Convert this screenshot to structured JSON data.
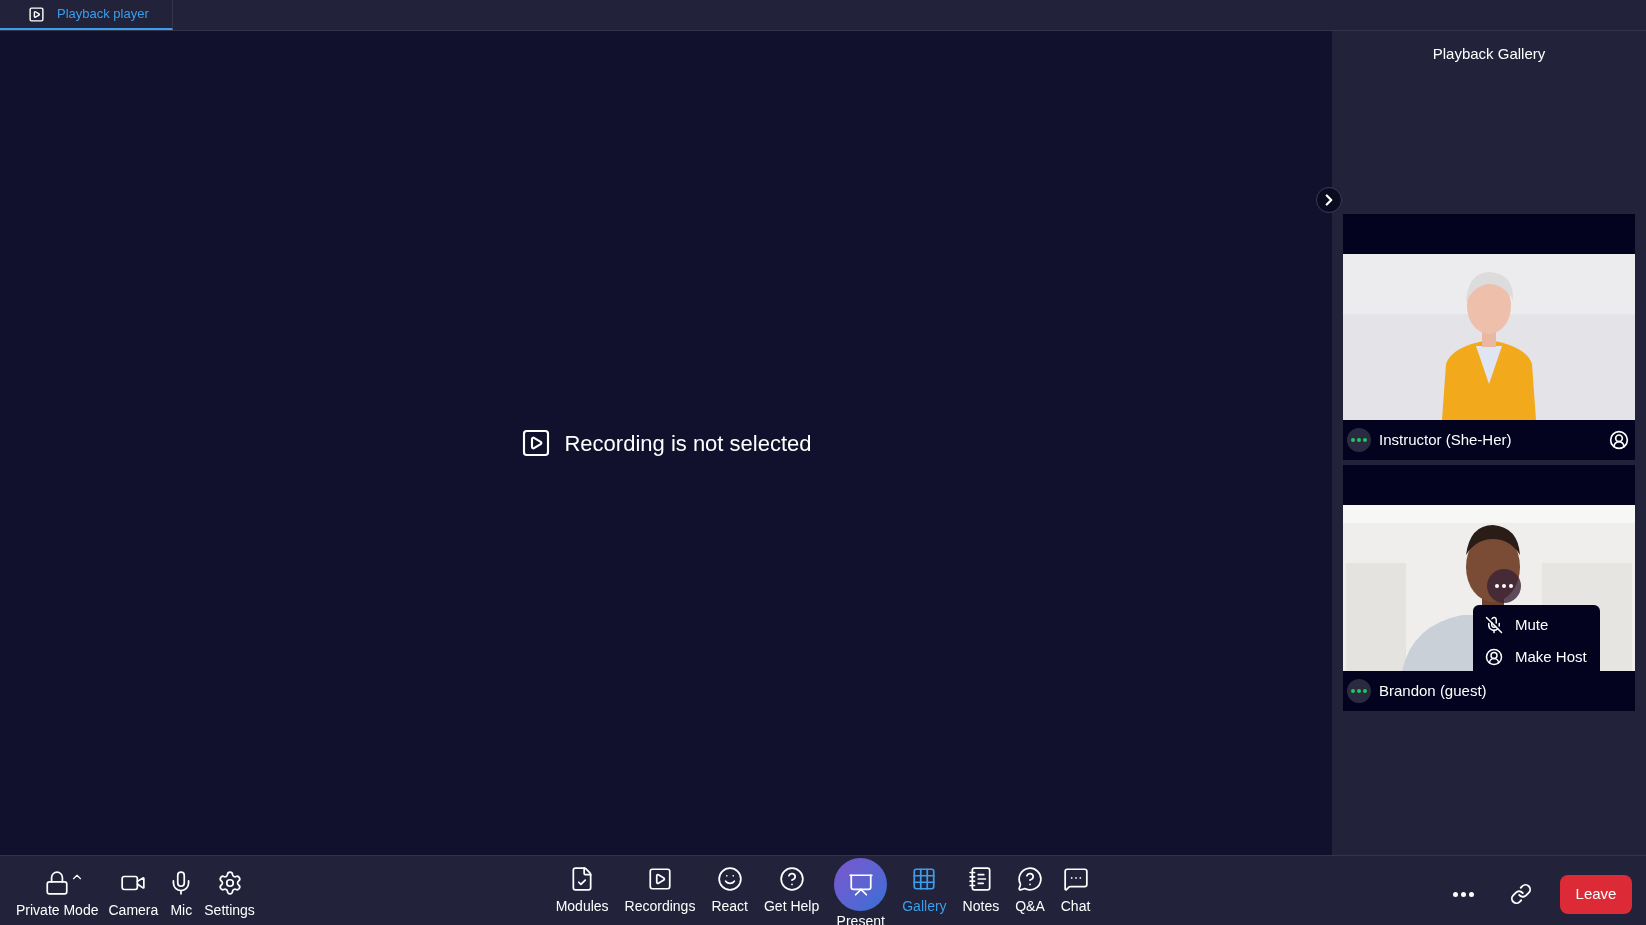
{
  "tab": {
    "label": "Playback player",
    "selected": true
  },
  "main": {
    "message": "Recording is not selected"
  },
  "gallery": {
    "title": "Playback Gallery",
    "tiles": [
      {
        "name": "Instructor (She-Her)",
        "host": true,
        "menu_open": false
      },
      {
        "name": "Brandon (guest)",
        "host": false,
        "menu_open": true,
        "menu": [
          {
            "label": "Mute"
          },
          {
            "label": "Make Host"
          }
        ]
      }
    ]
  },
  "toolbar": {
    "left": [
      {
        "label": "Private Mode"
      },
      {
        "label": "Camera"
      },
      {
        "label": "Mic"
      },
      {
        "label": "Settings"
      }
    ],
    "center": [
      {
        "label": "Modules",
        "kind": "plain",
        "selected": false
      },
      {
        "label": "Recordings",
        "kind": "plain",
        "selected": false
      },
      {
        "label": "React",
        "kind": "plain",
        "selected": false
      },
      {
        "label": "Get Help",
        "kind": "plain",
        "selected": false
      },
      {
        "label": "Present",
        "kind": "round",
        "selected": false
      },
      {
        "label": "Gallery",
        "kind": "plain",
        "selected": true
      },
      {
        "label": "Notes",
        "kind": "plain",
        "selected": false
      },
      {
        "label": "Q&A",
        "kind": "plain",
        "selected": false
      },
      {
        "label": "Chat",
        "kind": "plain",
        "selected": false
      }
    ],
    "leave": "Leave"
  }
}
